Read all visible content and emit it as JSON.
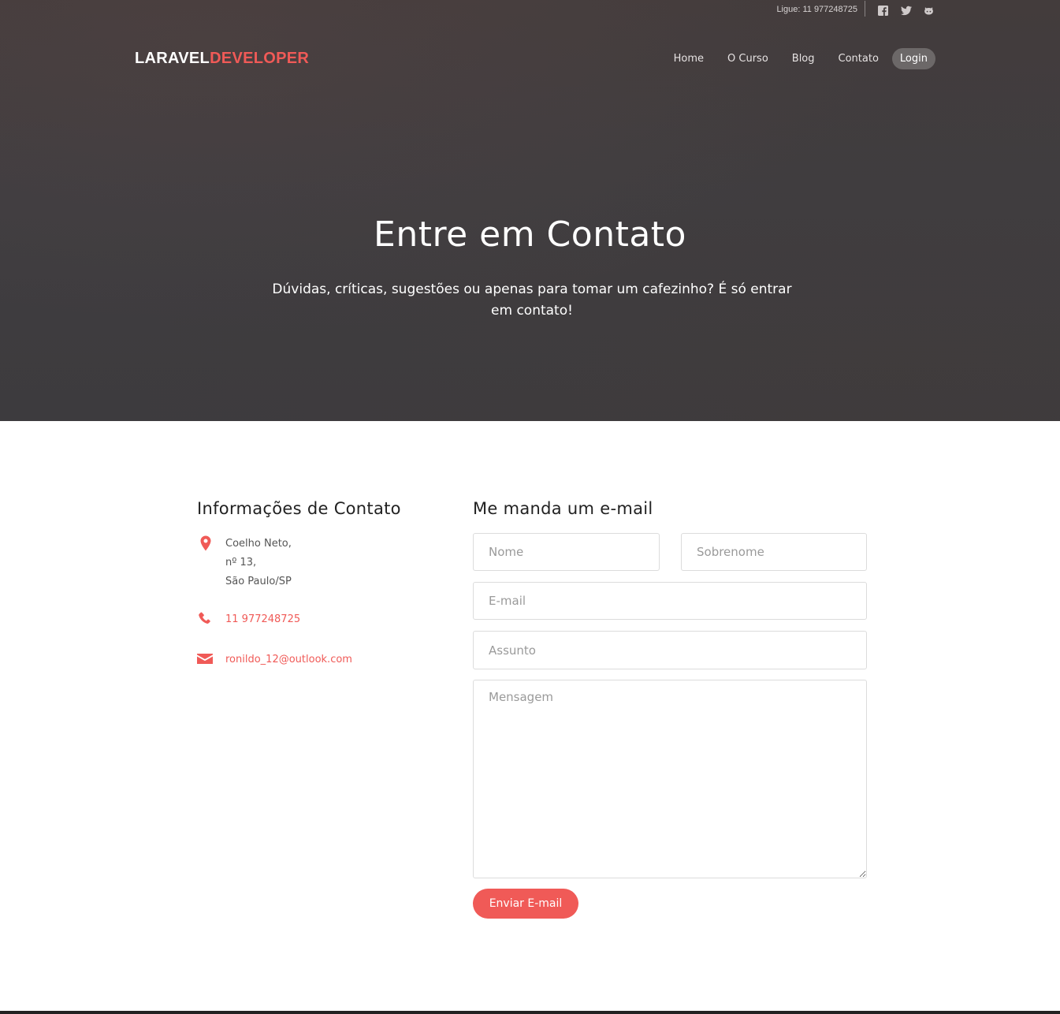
{
  "topbar": {
    "phone": "Ligue: 11 977248725",
    "social": [
      "facebook-icon",
      "twitter-icon",
      "github-icon"
    ]
  },
  "logo": {
    "part1": "LARAVEL",
    "part2": "DEVELOPER"
  },
  "nav": {
    "items": [
      "Home",
      "O Curso",
      "Blog",
      "Contato"
    ],
    "login": "Login"
  },
  "hero": {
    "title": "Entre em Contato",
    "subtitle": "Dúvidas, críticas, sugestões ou apenas para tomar um cafezinho? É só entrar em contato!"
  },
  "info": {
    "title": "Informações de Contato",
    "address": [
      "Coelho Neto,",
      "nº 13,",
      "São Paulo/SP"
    ],
    "phone": "11 977248725",
    "email": "ronildo_12@outlook.com"
  },
  "form": {
    "title": "Me manda um e-mail",
    "first_name_placeholder": "Nome",
    "last_name_placeholder": "Sobrenome",
    "email_placeholder": "E-mail",
    "subject_placeholder": "Assunto",
    "message_placeholder": "Mensagem",
    "submit": "Enviar E-mail"
  },
  "colors": {
    "accent": "#f05a57",
    "hero_bg": "#3f3d40"
  }
}
